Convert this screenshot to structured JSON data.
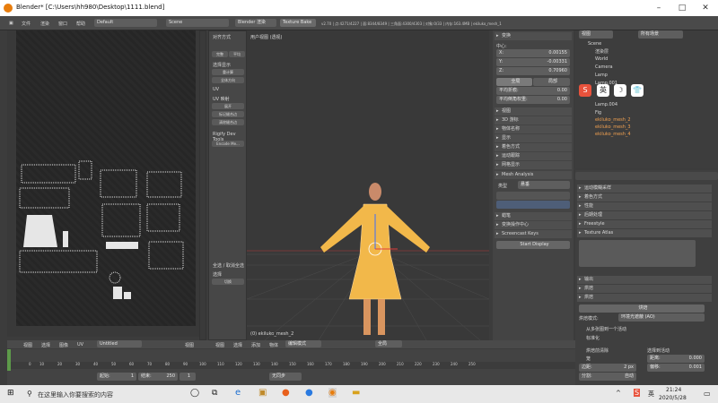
{
  "window": {
    "title": "Blender* [C:\\Users\\hh980\\Desktop\\1111.blend]",
    "min": "–",
    "max": "□",
    "close": "✕"
  },
  "menu": {
    "file": "文件",
    "render_dd": "渲染",
    "window": "窗口",
    "help": "帮助",
    "screen_field": "Default",
    "scene_field": "Scene",
    "engine": "Blender 渲染",
    "texture_bake": "Texture Bake",
    "stats": "v2.70 | 点:4271/4227 | 面:8344/8349 | 三角面:4300/4303 | 对象:0/33 | 内存:163.4MB | ekiluko_mesh_1"
  },
  "uv_tools": {
    "align": "对齐方式",
    "xaxis": "完整",
    "yaxis": "平均",
    "snap": "选择显示",
    "scale": "重计算",
    "flip": "全体方向",
    "uv_header": "UV",
    "uv_unwrap": "UV 映射",
    "unwrap": "展开",
    "mark_seam": "标记缝合边",
    "clear_seam": "清除缝合边",
    "rigify": "Rigify Dev Tools",
    "encode": "Encode Me...",
    "select_header": "全选 / 取消全选",
    "select_label": "选择",
    "select_value": "切换"
  },
  "viewport": {
    "label": "用户视图 (透视)",
    "object_label": "(0) ekiluko_mesh_2"
  },
  "props_panel": {
    "transform": "变换",
    "median": "中心:",
    "x_label": "X:",
    "x_val": "0.00155",
    "y_label": "Y:",
    "y_val": "-0.00331",
    "z_label": "Z:",
    "z_val": "0.70960",
    "global": "全局",
    "local": "局部",
    "mean_crease": "平均折痕:",
    "mean_crease_val": "0.00",
    "mean_weight": "平均倒角权重:",
    "mean_weight_val": "0.00",
    "sections": [
      "视图",
      "3D 游标",
      "物体名称",
      "显示",
      "着色方式",
      "运动跟踪",
      "网格显示"
    ],
    "mesh_analysis": "Mesh Analysis",
    "type_label": "类型",
    "type_value": "悬垂",
    "grease": "蜡笔",
    "items2": [
      "变换操作中心",
      "Screencast Keys"
    ],
    "start_display": "Start Display"
  },
  "outliner": {
    "view_field": "视图",
    "search_field": "所有场景",
    "items": [
      "Scene",
      "渲染层",
      "World",
      "Camera",
      "Lamp",
      "Lamp.001",
      "Lamp.004",
      "Fig",
      "ekiluko_mesh_2",
      "ekiluko_mesh_3",
      "ekiluko_mesh_4"
    ]
  },
  "overlay_icons": {
    "ime_s": "S",
    "ime_lang": "英",
    "ime_moon": "☽",
    "ime_shirt": "👕"
  },
  "render_props": {
    "motion": "运动模糊采样",
    "dim": "着色方式",
    "perf": "性能",
    "post": "后期处理",
    "freestyle": "Freestyle",
    "texture_atlas": "Texture Atlas",
    "bake_header": "烘焙",
    "bake_btn": "烘焙",
    "bake_mode_label": "烘焙模式:",
    "bake_mode": "环境光遮蔽 (AO)",
    "items": [
      "输出",
      "烘焙"
    ],
    "selected_to_active": "选择到活动",
    "normalized": "标准化",
    "clear": "烘焙前清除",
    "cage": "笼",
    "margin": "边距:",
    "margin_val": "2 px",
    "dist": "距离:",
    "dist_val": "0.000",
    "bias": "偏移:",
    "bias_val": "0.001",
    "split": "分割:",
    "split_val": "自动",
    "ao_from": "从多张图到一个活动"
  },
  "uv_header": {
    "view": "视图",
    "select": "选择",
    "image": "图像",
    "uv": "UV",
    "image_name": "Untitled",
    "uv_field": "视图"
  },
  "view3d_header": {
    "view": "视图",
    "select": "选择",
    "add": "添加",
    "object": "物体",
    "mode": "编辑模式",
    "pivot": "全局"
  },
  "timeline": {
    "start_label": "起始:",
    "start": "1",
    "end_label": "结束:",
    "end": "250",
    "current": "1",
    "sync": "无同步",
    "ticks": [
      "0",
      "10",
      "20",
      "30",
      "40",
      "50",
      "60",
      "70",
      "80",
      "90",
      "100",
      "110",
      "120",
      "130",
      "140",
      "150",
      "160",
      "170",
      "180",
      "190",
      "200",
      "210",
      "220",
      "230",
      "240",
      "250"
    ]
  },
  "taskbar": {
    "search_placeholder": "在这里输入你要搜索的内容",
    "time": "21:24",
    "date": "2020/5/28",
    "lang": "英"
  },
  "colors": {
    "accent": "#e87d0d",
    "mesh": "#f2b84a",
    "panel": "#474747",
    "viewport": "#393939"
  }
}
